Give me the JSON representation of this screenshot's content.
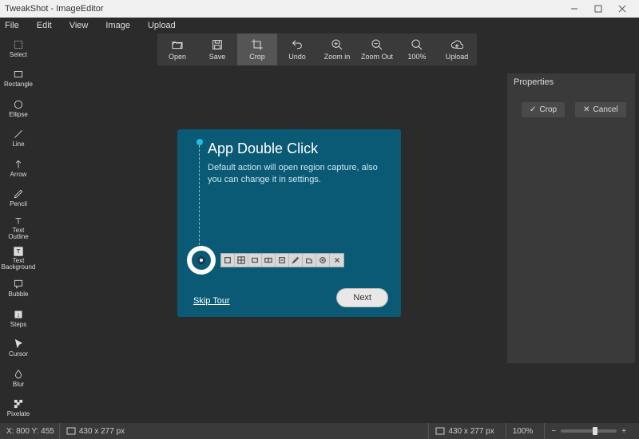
{
  "title": "TweakShot - ImageEditor",
  "menu": [
    "File",
    "Edit",
    "View",
    "Image",
    "Upload"
  ],
  "toolbar": [
    {
      "id": "open",
      "label": "Open"
    },
    {
      "id": "save",
      "label": "Save"
    },
    {
      "id": "crop",
      "label": "Crop",
      "active": true
    },
    {
      "id": "undo",
      "label": "Undo"
    },
    {
      "id": "zoomin",
      "label": "Zoom in"
    },
    {
      "id": "zoomout",
      "label": "Zoom Out"
    },
    {
      "id": "zoom100",
      "label": "100%"
    },
    {
      "id": "upload",
      "label": "Upload"
    }
  ],
  "sidebar": [
    {
      "id": "select",
      "label": "Select"
    },
    {
      "id": "rectangle",
      "label": "Rectangle"
    },
    {
      "id": "ellipse",
      "label": "Ellipse"
    },
    {
      "id": "line",
      "label": "Line"
    },
    {
      "id": "arrow",
      "label": "Arrow"
    },
    {
      "id": "pencil",
      "label": "Pencil"
    },
    {
      "id": "text-outline",
      "label": "Text\nOutline"
    },
    {
      "id": "text-bg",
      "label": "Text\nBackground"
    },
    {
      "id": "bubble",
      "label": "Bubble"
    },
    {
      "id": "steps",
      "label": "Steps"
    },
    {
      "id": "cursor",
      "label": "Cursor"
    },
    {
      "id": "blur",
      "label": "Blur"
    },
    {
      "id": "pixelate",
      "label": "Pixelate"
    }
  ],
  "properties": {
    "title": "Properties",
    "crop": "Crop",
    "cancel": "Cancel"
  },
  "tour": {
    "title": "App Double Click",
    "body": "Default action will open region capture, also you can change it in settings.",
    "skip": "Skip Tour",
    "next": "Next"
  },
  "status": {
    "coords": "X: 800 Y: 455",
    "dim1": "430 x 277 px",
    "dim2": "430 x 277 px",
    "zoom": "100%"
  }
}
